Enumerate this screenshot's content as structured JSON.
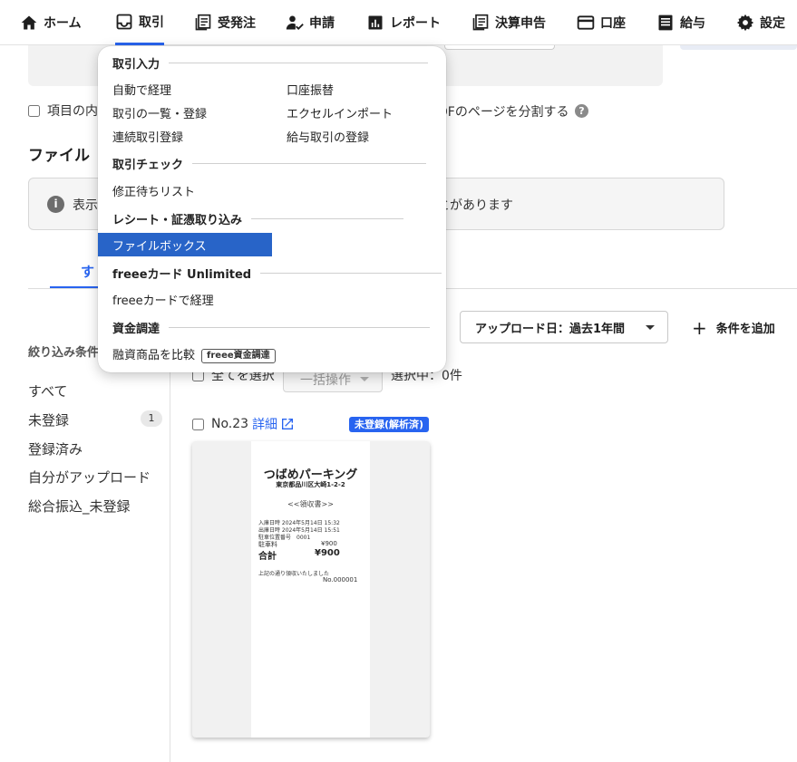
{
  "nav": {
    "items": [
      {
        "label": "ホーム",
        "icon": "home-icon"
      },
      {
        "label": "取引",
        "icon": "inbox-icon"
      },
      {
        "label": "受発注",
        "icon": "documents-icon"
      },
      {
        "label": "申請",
        "icon": "person-check-icon"
      },
      {
        "label": "レポート",
        "icon": "bar-chart-icon"
      },
      {
        "label": "決算申告",
        "icon": "documents-icon"
      },
      {
        "label": "口座",
        "icon": "credit-card-icon"
      },
      {
        "label": "給与",
        "icon": "payslip-icon"
      },
      {
        "label": "設定",
        "icon": "gear-icon"
      }
    ],
    "active": "取引"
  },
  "page": {
    "split_checkbox_label": "項目の内",
    "split_text_tail": "DFのページを分割する",
    "help": "?",
    "title": "ファイル",
    "info_icon": "i",
    "info_text_head": "表示",
    "info_text_tail": "とがあります",
    "tab_all": "す"
  },
  "sidebar": {
    "filter_label": "絞り込み条件",
    "items": [
      {
        "label": "すべて"
      },
      {
        "label": "未登録",
        "count": "1"
      },
      {
        "label": "登録済み"
      },
      {
        "label": "自分がアップロード"
      },
      {
        "label": "総合振込_未登録"
      }
    ]
  },
  "toolbar": {
    "date_filter": "アップロード日：過去1年間",
    "add_condition": "条件を追加",
    "select_all": "全てを選択",
    "bulk_action": "一括操作",
    "selected_count": "選択中：0件"
  },
  "file_item": {
    "number": "No.23",
    "detail_link": "詳細",
    "status": "未登録(解析済)",
    "receipt": {
      "title": "つばめパーキング",
      "address": "東京都品川区大崎1-2-2",
      "kind": "<<領収書>>",
      "entry": "入庫日時 2024年5月14日 15:32",
      "exit": "出庫日時 2024年5月14日 15:51",
      "space": "駐車位置番号　0001",
      "fee_label": "駐車料",
      "fee_value": "¥900",
      "total_label": "合計",
      "total_value": "¥900",
      "thanks": "上記の通り領収いたしました",
      "receipt_no": "No.000001"
    }
  },
  "menu": {
    "sections": [
      {
        "title": "取引入力",
        "items": [
          "自動で経理",
          "口座振替",
          "取引の一覧・登録",
          "エクセルインポート",
          "連続取引登録",
          "給与取引の登録"
        ]
      },
      {
        "title": "取引チェック",
        "items": [
          "修正待ちリスト"
        ]
      },
      {
        "title": "レシート・証憑取り込み",
        "items": [
          "ファイルボックス"
        ]
      },
      {
        "title": "freeeカード Unlimited",
        "items": [
          "freeeカードで経理"
        ]
      },
      {
        "title": "資金調達",
        "items": [
          "融資商品を比較"
        ],
        "badge": "freee資金調達"
      }
    ],
    "selected": "ファイルボックス"
  },
  "colors": {
    "accent": "#2864f0",
    "menu_selected": "#2864c8",
    "badge_blue": "#2864f0"
  }
}
